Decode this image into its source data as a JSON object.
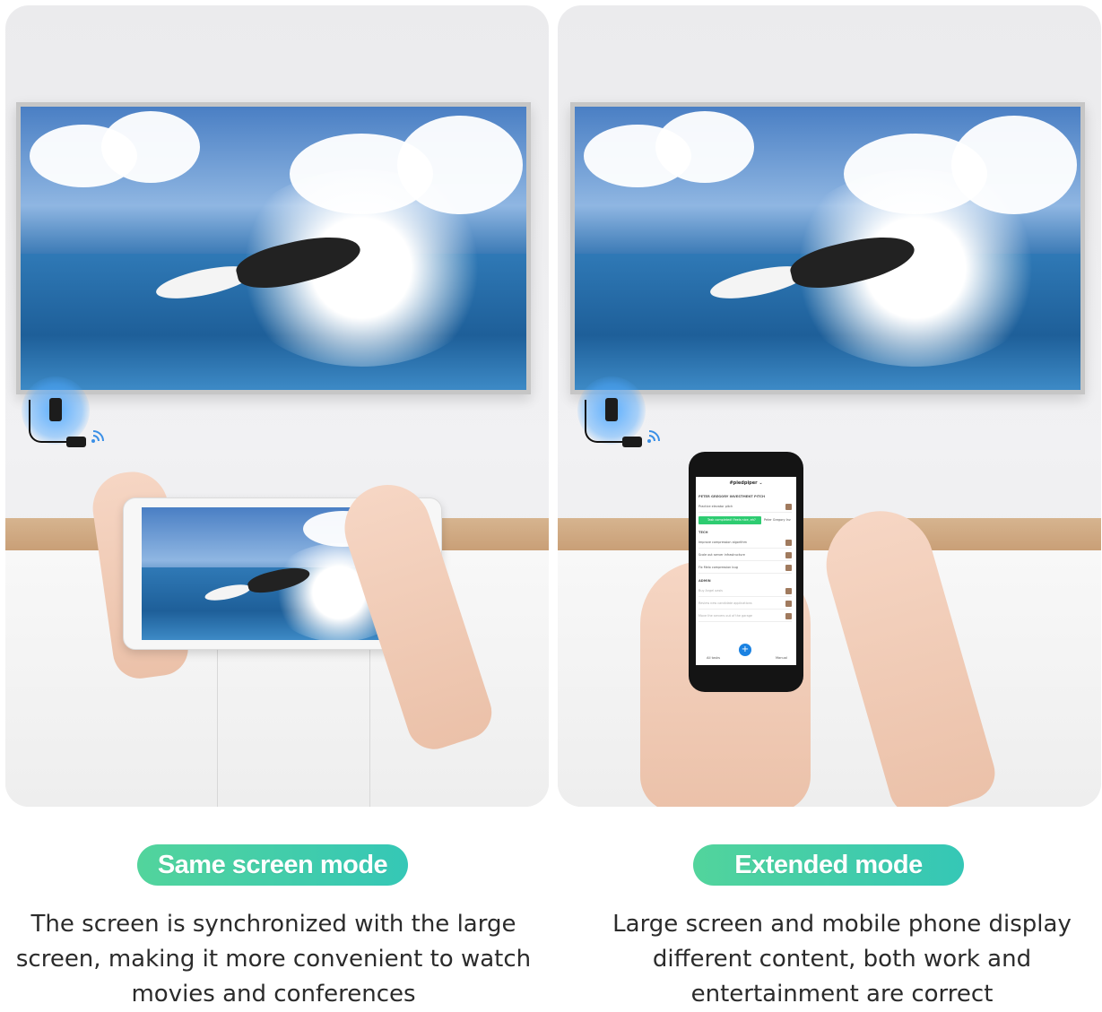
{
  "modes": [
    {
      "label": "Same screen mode",
      "description": "The screen is synchronized with the large screen, making it more convenient to watch movies and conferences"
    },
    {
      "label": "Extended mode",
      "description": "Large screen and mobile phone display different content, both work and entertainment are correct"
    }
  ],
  "phone_app": {
    "title": "#piedpiper ⌄",
    "section_1": "PETER GREGORY INVESTMENT PITCH",
    "row_1": "Practice elevator pitch",
    "toast": "Task completed! Feels nice, eh?",
    "toast_side": "Peter Gregory Inv",
    "section_2": "TECH",
    "row_2": "Improve compression algorithm",
    "row_3": "Scale out server infrastructure",
    "row_4": "Fix Melo compression bug",
    "section_3": "ADMIN",
    "row_5": "Buy Angel oasis",
    "row_6": "Review new candidate applications",
    "row_7": "Move the servers out of the garage",
    "bottom_left": "All tasks",
    "bottom_right": "Manual",
    "fab": "+"
  },
  "colors": {
    "pill_start": "#52d49c",
    "pill_end": "#35c7b6",
    "dongle_glow": "#4ea8ff"
  }
}
